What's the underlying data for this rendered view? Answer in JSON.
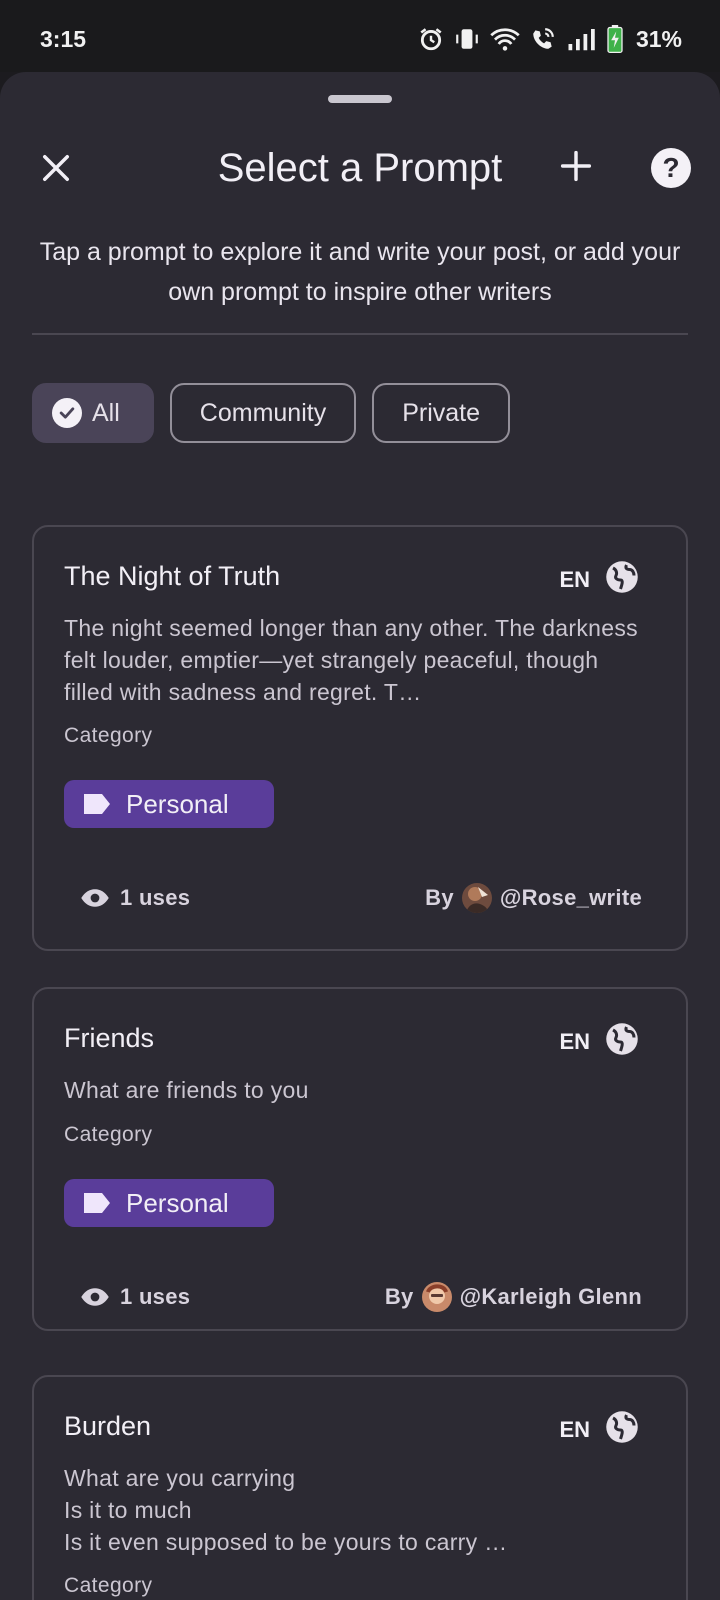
{
  "status_bar": {
    "time": "3:15",
    "battery": "31%",
    "icons": [
      "alarm-icon",
      "vibrate-icon",
      "wifi-icon",
      "wifi-calling-icon",
      "signal-icon",
      "battery-charging-icon"
    ]
  },
  "header": {
    "title": "Select a Prompt",
    "close_icon": "close-icon",
    "add_icon": "plus-icon",
    "help_label": "?"
  },
  "subtitle": "Tap a prompt to explore it and write your post, or add your own prompt to inspire other writers",
  "filters": [
    {
      "label": "All",
      "selected": true
    },
    {
      "label": "Community",
      "selected": false
    },
    {
      "label": "Private",
      "selected": false
    }
  ],
  "prompts": [
    {
      "title": "The Night of Truth",
      "language": "EN",
      "description": "The night seemed longer than any other. The darkness felt louder, emptier—yet strangely peaceful, though filled with sadness and regret. T…",
      "category_label": "Category",
      "category": "Personal",
      "uses": "1 uses",
      "by_label": "By",
      "author": "@Rose_write"
    },
    {
      "title": "Friends",
      "language": "EN",
      "description": "What are friends to you",
      "category_label": "Category",
      "category": "Personal",
      "uses": "1 uses",
      "by_label": "By",
      "author": "@Karleigh Glenn"
    },
    {
      "title": "Burden",
      "language": "EN",
      "description": "What are you carrying\nIs it to much\nIs it even supposed to be yours to carry …",
      "category_label": "Category"
    }
  ],
  "colors": {
    "sheet": "#2c2a33",
    "tag": "#5a3d9a",
    "selected_chip": "#4a4458",
    "card_border": "#4a4751"
  }
}
